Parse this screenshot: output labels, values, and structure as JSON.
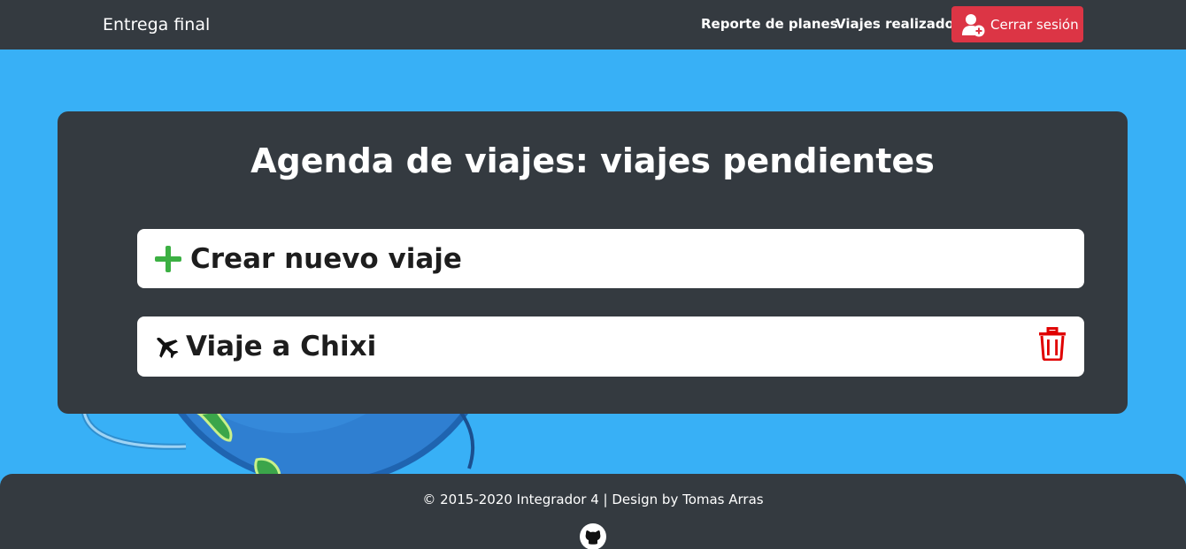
{
  "navbar": {
    "brand": "Entrega final",
    "links": [
      "Reporte de planes",
      "Viajes realizados"
    ],
    "logout_label": "Cerrar sesión",
    "logout_icon": "user-plus-icon",
    "logout_color": "#dc3545"
  },
  "main": {
    "title": "Agenda de viajes: viajes pendientes",
    "new_trip_label": "Crear nuevo viaje",
    "new_trip_icon": "plus-icon",
    "trips": [
      {
        "label": "Viaje a Chixi",
        "icon": "plane-icon",
        "action_icon": "trash-icon"
      }
    ]
  },
  "footer": {
    "text": "© 2015-2020 Integrador 4 | Design by Tomas Arras",
    "icon": "github-icon"
  },
  "colors": {
    "background": "#38b0f6",
    "dark": "#343a40",
    "accent_green": "#3cb043",
    "danger_red": "#e00000"
  }
}
